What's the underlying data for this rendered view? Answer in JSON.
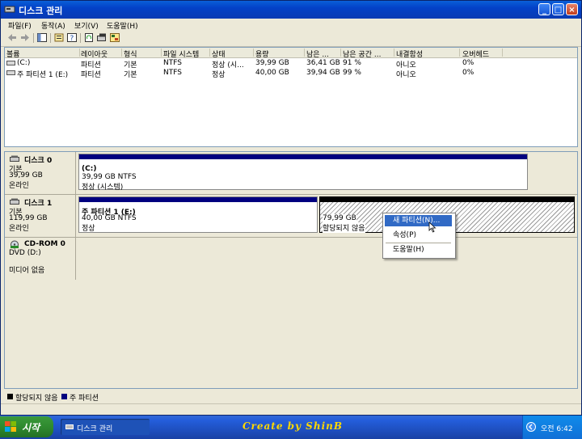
{
  "window": {
    "title": "디스크 관리"
  },
  "menu": [
    {
      "label": "파일(F)"
    },
    {
      "label": "동작(A)"
    },
    {
      "label": "보기(V)"
    },
    {
      "label": "도움말(H)"
    }
  ],
  "list": {
    "columns": [
      "볼륨",
      "레이아웃",
      "형식",
      "파일 시스템",
      "상태",
      "용량",
      "남은 ...",
      "남은 공간 ...",
      "내결함성",
      "오버헤드"
    ],
    "rows": [
      {
        "volume": "(C:)",
        "layout": "파티션",
        "type": "기본",
        "fs": "NTFS",
        "status": "정상 (시...",
        "capacity": "39,99 GB",
        "free": "36,41 GB",
        "free_pct": "91 %",
        "fault": "아니오",
        "overhead": "0%"
      },
      {
        "volume": "주 파티션 1 (E:)",
        "layout": "파티션",
        "type": "기본",
        "fs": "NTFS",
        "status": "정상",
        "capacity": "40,00 GB",
        "free": "39,94 GB",
        "free_pct": "99 %",
        "fault": "아니오",
        "overhead": "0%"
      }
    ]
  },
  "disks": [
    {
      "name": "디스크 0",
      "type": "기본",
      "size": "39,99 GB",
      "state": "온라인",
      "partitions": [
        {
          "name": "(C:)",
          "size": "39,99 GB NTFS",
          "status": "정상 (시스템)"
        }
      ]
    },
    {
      "name": "디스크 1",
      "type": "기본",
      "size": "119,99 GB",
      "state": "온라인",
      "partitions": [
        {
          "name": "주 파티션 1  (E:)",
          "size": "40,00 GB NTFS",
          "status": "정상"
        },
        {
          "name": "",
          "size": "79,99 GB",
          "status": "할당되지 않음"
        }
      ]
    },
    {
      "name": "CD-ROM 0",
      "type": "DVD (D:)",
      "size": "",
      "state": "미디어 없음",
      "partitions": []
    }
  ],
  "context_menu": {
    "items": [
      "새 파티션(N)...",
      "속성(P)",
      "도움말(H)"
    ],
    "selected_index": 0
  },
  "legend": [
    {
      "label": "할당되지 않음",
      "color": "#000000"
    },
    {
      "label": "주 파티션",
      "color": "#00007f"
    }
  ],
  "taskbar": {
    "start_label": "시작",
    "task_label": "디스크 관리",
    "brand": "Create by ShinB",
    "clock": "오전 6:42"
  },
  "colors": {
    "primary_partition": "#00007f",
    "unallocated": "#000000",
    "selection": "#316ac5"
  }
}
